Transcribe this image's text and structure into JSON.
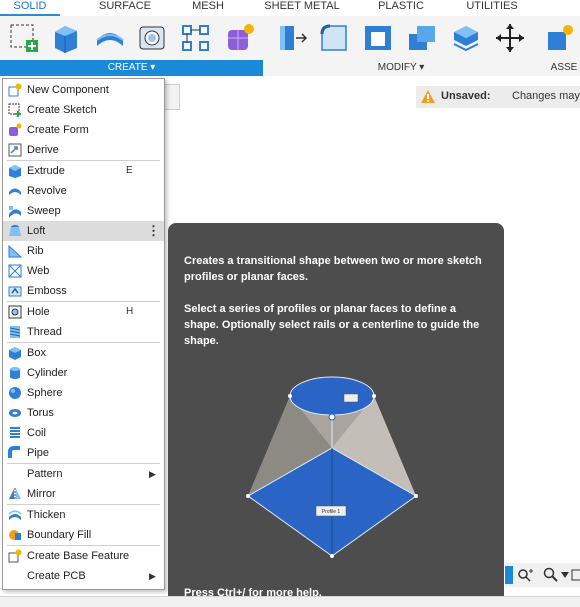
{
  "tabs": [
    "SOLID",
    "SURFACE",
    "MESH",
    "SHEET METAL",
    "PLASTIC",
    "UTILITIES"
  ],
  "groups": {
    "create": "CREATE ▾",
    "modify": "MODIFY ▾",
    "assemble": "ASSE"
  },
  "unsaved": {
    "label": "Unsaved:",
    "text": "Changes may"
  },
  "menu": {
    "new_component": "New Component",
    "create_sketch": "Create Sketch",
    "create_form": "Create Form",
    "derive": "Derive",
    "extrude": "Extrude",
    "extrude_sc": "E",
    "revolve": "Revolve",
    "sweep": "Sweep",
    "loft": "Loft",
    "loft_more": "⋮",
    "rib": "Rib",
    "web": "Web",
    "emboss": "Emboss",
    "hole": "Hole",
    "hole_sc": "H",
    "thread": "Thread",
    "box": "Box",
    "cylinder": "Cylinder",
    "sphere": "Sphere",
    "torus": "Torus",
    "coil": "Coil",
    "pipe": "Pipe",
    "pattern": "Pattern",
    "mirror": "Mirror",
    "thicken": "Thicken",
    "boundary_fill": "Boundary Fill",
    "create_base_feature": "Create Base Feature",
    "create_pcb": "Create PCB",
    "submenu_arrow": "▶"
  },
  "tooltip": {
    "desc1": "Creates a transitional shape between two or more sketch profiles or planar faces.",
    "desc2": "Select a series of profiles or planar faces to define a shape. Optionally select rails or a centerline to guide the shape.",
    "profile_label": "Profile 1",
    "help": "Press Ctrl+/ for more help."
  },
  "colors": {
    "accent": "#1a8ad8",
    "tooltip_bg": "#4d4d4d",
    "shape_blue": "#2a64c4"
  }
}
